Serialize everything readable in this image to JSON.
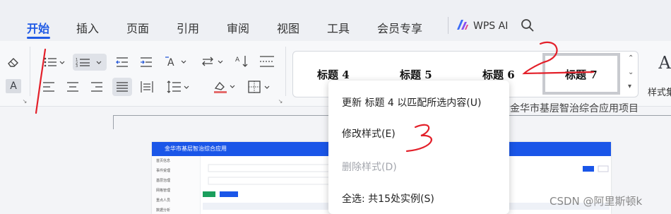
{
  "tabs": [
    {
      "label": "开始",
      "active": true
    },
    {
      "label": "插入"
    },
    {
      "label": "页面"
    },
    {
      "label": "引用"
    },
    {
      "label": "审阅"
    },
    {
      "label": "视图"
    },
    {
      "label": "工具"
    },
    {
      "label": "会员专享"
    }
  ],
  "wps_ai": {
    "label": "WPS AI",
    "icon": "wps-ai-logo-icon"
  },
  "search_icon": "search-icon",
  "styles_gallery": {
    "items": [
      "标题 4",
      "标题 5",
      "标题 6",
      "标题 7"
    ],
    "more_label": "样式集"
  },
  "context_menu": {
    "update": "更新 标题 4 以匹配所选内容(U)",
    "modify": "修改样式(E)",
    "delete": "删除样式(D)",
    "select_all": "全选: 共15处实例(S)"
  },
  "document": {
    "header_text": "金华市基层智治综合应用项目",
    "embedded_title": "金华市基层智治综合应用",
    "embedded_side_items": [
      "首页信息",
      "事件受理",
      "基层治理",
      "网格管理",
      "重点人员",
      "数据分析"
    ]
  },
  "watermark": "CSDN @阿里斯顿k",
  "colors": {
    "accent": "#1f5ae5",
    "annotation_red": "#e3202a"
  }
}
